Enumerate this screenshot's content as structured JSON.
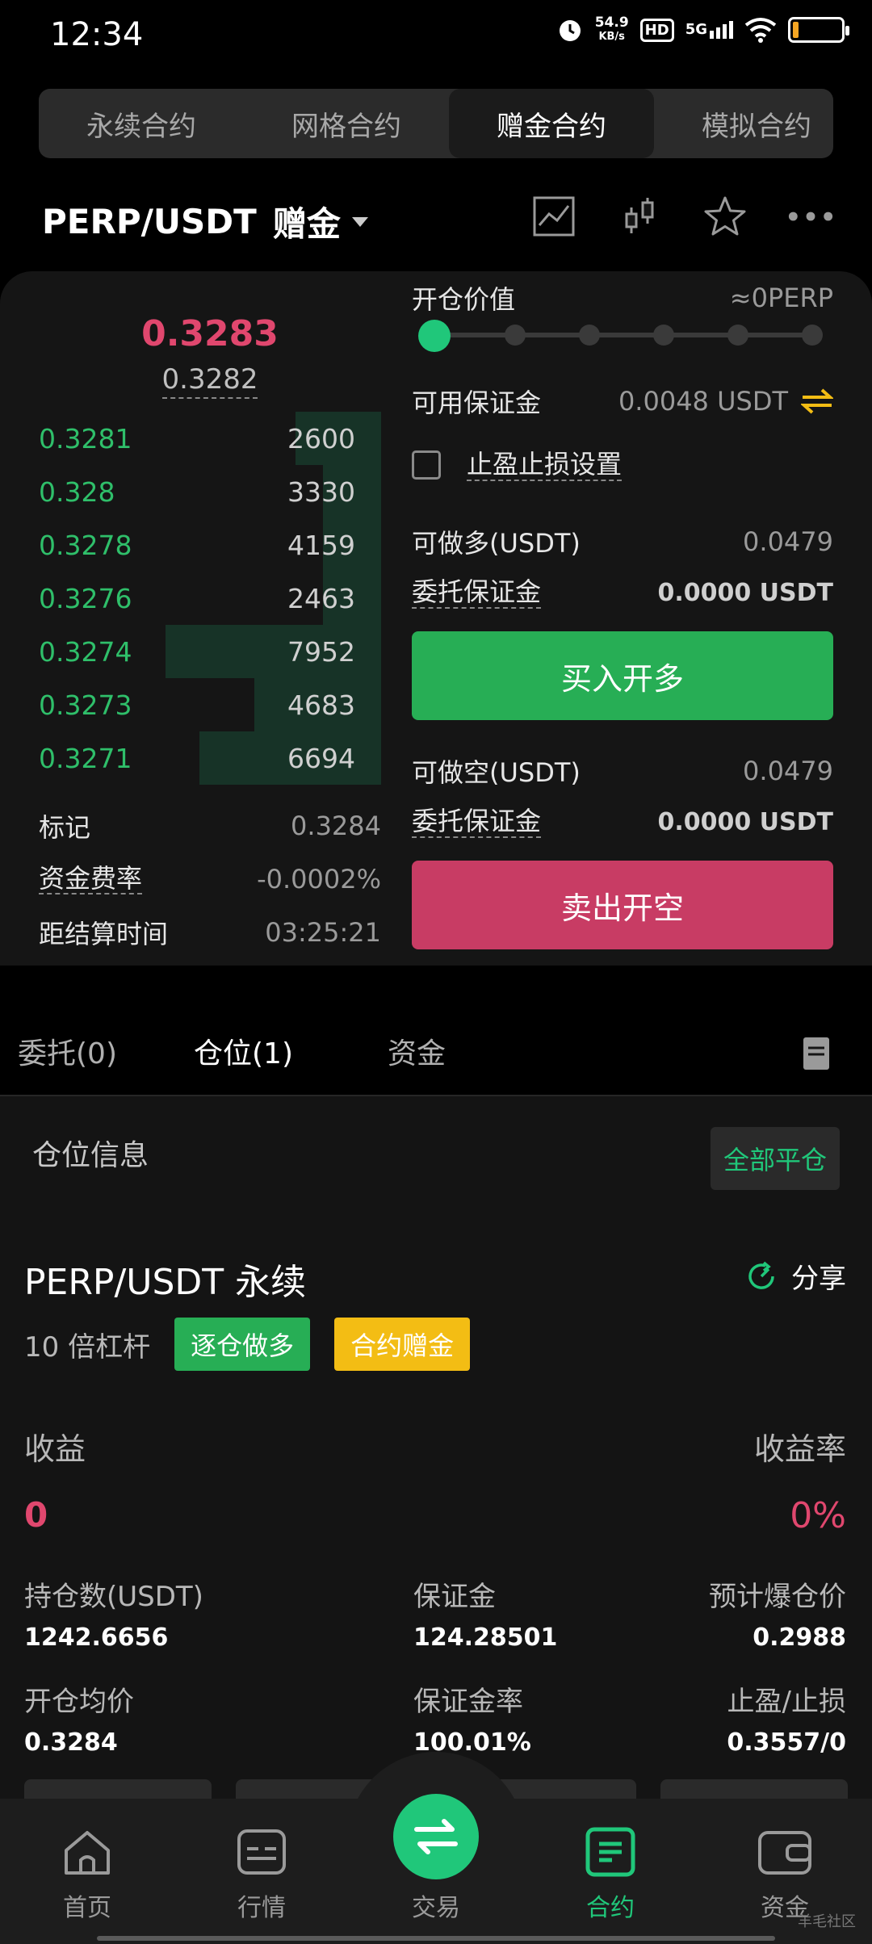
{
  "status": {
    "time": "12:34",
    "net_speed": "54.9",
    "net_unit": "KB/s",
    "hd": "HD",
    "signal": "5G"
  },
  "tabs": [
    {
      "label": "永续合约"
    },
    {
      "label": "网格合约"
    },
    {
      "label": "赠金合约"
    },
    {
      "label": "模拟合约"
    }
  ],
  "header": {
    "pair": "PERP/USDT",
    "mode": "赠金"
  },
  "book": {
    "last_price": "0.3283",
    "mark_price": "0.3282",
    "bids": [
      {
        "price": "0.3281",
        "qty": "2600",
        "depth": 0.25
      },
      {
        "price": "0.328",
        "qty": "3330",
        "depth": 0.17
      },
      {
        "price": "0.3278",
        "qty": "4159",
        "depth": 0.17
      },
      {
        "price": "0.3276",
        "qty": "2463",
        "depth": 0.17
      },
      {
        "price": "0.3274",
        "qty": "7952",
        "depth": 0.63
      },
      {
        "price": "0.3273",
        "qty": "4683",
        "depth": 0.37
      },
      {
        "price": "0.3271",
        "qty": "6694",
        "depth": 0.53
      }
    ],
    "mark_label": "标记",
    "mark_value": "0.3284",
    "funding_label": "资金费率",
    "funding_value": "-0.0002%",
    "settle_label": "距结算时间",
    "settle_value": "03:25:21"
  },
  "form": {
    "open_value_label": "开仓价值",
    "open_value": "≈0PERP",
    "available_label": "可用保证金",
    "available_value": "0.0048 USDT",
    "tpsl_label": "止盈止损设置",
    "long_label": "可做多(USDT)",
    "long_value": "0.0479",
    "margin_label": "委托保证金",
    "margin_value": "0.0000 USDT",
    "buy_label": "买入开多",
    "short_label": "可做空(USDT)",
    "short_value": "0.0479",
    "margin_label2": "委托保证金",
    "margin_value2": "0.0000 USDT",
    "sell_label": "卖出开空"
  },
  "subtabs": {
    "orders": "委托(0)",
    "positions": "仓位(1)",
    "funds": "资金"
  },
  "position": {
    "section_title": "仓位信息",
    "close_all": "全部平仓",
    "title": "PERP/USDT 永续",
    "share": "分享",
    "leverage": "10 倍杠杆",
    "tag_side": "逐仓做多",
    "tag_bonus": "合约赠金",
    "pnl_label": "收益",
    "pnl_value": "0",
    "roe_label": "收益率",
    "roe_value": "0%",
    "size_label": "持仓数(USDT)",
    "size_value": "1242.6656",
    "margin_label": "保证金",
    "margin_value": "124.28501",
    "liq_label": "预计爆仓价",
    "liq_value": "0.2988",
    "entry_label": "开仓均价",
    "entry_value": "0.3284",
    "margin_rate_label": "保证金率",
    "margin_rate_value": "100.01%",
    "tpsl_label": "止盈/止损",
    "tpsl_value": "0.3557/0"
  },
  "nav": {
    "home": "首页",
    "market": "行情",
    "trade": "交易",
    "futures": "合约",
    "assets": "资金"
  },
  "watermark": "羊毛社区",
  "colors": {
    "green": "#27ae55",
    "red": "#c83c64",
    "accent": "#20c77a",
    "yellow": "#f3bd14"
  }
}
